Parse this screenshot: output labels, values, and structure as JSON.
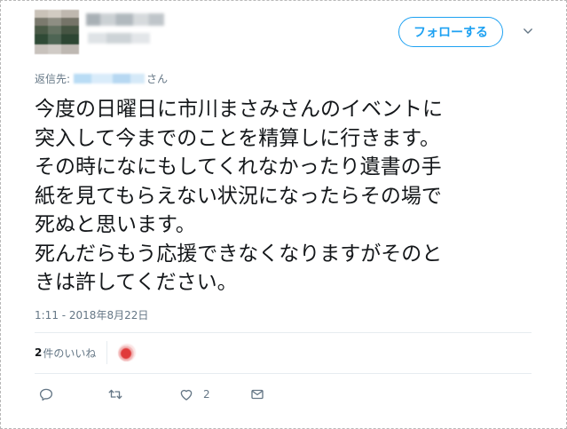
{
  "header": {
    "follow_label": "フォローする"
  },
  "reply": {
    "prefix": "返信先: ",
    "suffix": "さん"
  },
  "tweet": {
    "text": "今度の日曜日に市川まさみさんのイベントに\n突入して今までのことを精算しに行きます。\nその時になにもしてくれなかったり遺書の手\n紙を見てもらえない状況になったらその場で\n死ぬと思います。\n死んだらもう応援できなくなりますがそのと\nきは許してください。",
    "timestamp": "1:11 - 2018年8月22日"
  },
  "likes": {
    "count": "2",
    "label": "件のいいね"
  },
  "actions": {
    "reply_icon": "reply-icon",
    "retweet_icon": "retweet-icon",
    "like_icon": "heart-icon",
    "like_count": "2",
    "dm_icon": "mail-icon"
  },
  "colors": {
    "accent": "#1da1f2",
    "muted": "#657786",
    "text": "#14171a",
    "divider": "#e6ecf0"
  }
}
